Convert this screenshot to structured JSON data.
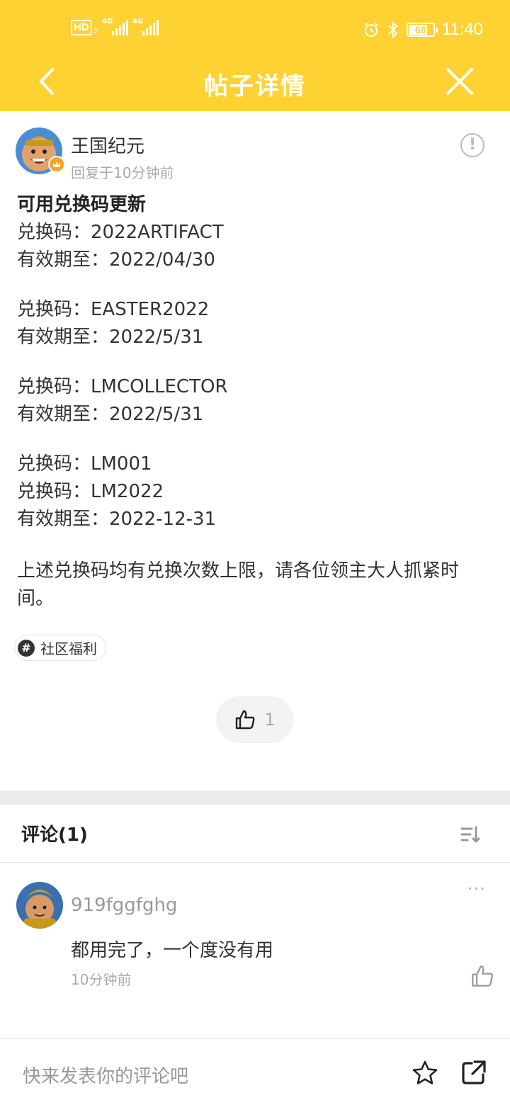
{
  "status_bar": {
    "hd_label": "HD",
    "hd_sub": "2",
    "network_1": "4G",
    "network_2": "4G",
    "battery": "68",
    "time": "11:40"
  },
  "nav": {
    "title": "帖子详情",
    "back_icon": "chevron-left-icon",
    "close_icon": "close-icon"
  },
  "post": {
    "author": "王国纪元",
    "time": "回复于10分钟前",
    "title": "可用兑换码更新",
    "blocks": [
      [
        "兑换码：2022ARTIFACT",
        "有效期至：2022/04/30"
      ],
      [
        "兑换码：EASTER2022",
        "有效期至：2022/5/31"
      ],
      [
        "兑换码：LMCOLLECTOR",
        "有效期至：2022/5/31"
      ],
      [
        "兑换码：LM001",
        "兑换码：LM2022",
        "有效期至：2022-12-31"
      ]
    ],
    "footer": "上述兑换码均有兑换次数上限，请各位领主大人抓紧时间。",
    "tag": "社区福利",
    "tag_icon": "#",
    "likes": "1"
  },
  "comments": {
    "title": "评论(1)",
    "items": [
      {
        "user": "919fggfghg",
        "text": "都用完了，一个度没有用",
        "time": "10分钟前",
        "more": "···"
      }
    ]
  },
  "input": {
    "placeholder": "快来发表你的评论吧"
  },
  "colors": {
    "brand": "#ffd233",
    "accent_badge": "#f5a623"
  }
}
